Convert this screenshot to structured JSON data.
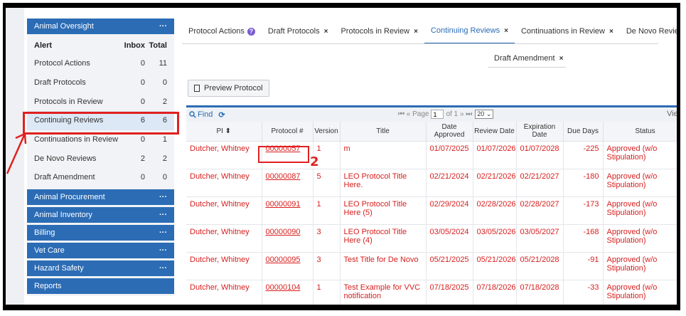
{
  "sidebar": {
    "oversight_title": "Animal Oversight",
    "col_alert": "Alert",
    "col_inbox": "Inbox",
    "col_total": "Total",
    "rows": [
      {
        "label": "Protocol Actions",
        "inbox": "0",
        "total": "11"
      },
      {
        "label": "Draft Protocols",
        "inbox": "0",
        "total": "0"
      },
      {
        "label": "Protocols in Review",
        "inbox": "0",
        "total": "2"
      },
      {
        "label": "Continuing Reviews",
        "inbox": "6",
        "total": "6"
      },
      {
        "label": "Continuations in Review",
        "inbox": "0",
        "total": "1"
      },
      {
        "label": "De Novo Reviews",
        "inbox": "2",
        "total": "2"
      },
      {
        "label": "Draft Amendment",
        "inbox": "0",
        "total": "0"
      }
    ],
    "sections": [
      "Animal Procurement",
      "Animal Inventory",
      "Billing",
      "Vet Care",
      "Hazard Safety",
      "Reports"
    ],
    "more": "···"
  },
  "tabs": {
    "protocol_actions": "Protocol Actions",
    "draft_protocols": "Draft Protocols",
    "protocols_in_review": "Protocols in Review",
    "continuing_reviews": "Continuing Reviews",
    "continuations_in_review": "Continuations in Review",
    "de_novo_reviews": "De Novo Reviews",
    "draft_amendment": "Draft Amendment",
    "close": "×",
    "help": "?"
  },
  "preview_button": "Preview Protocol",
  "grid": {
    "find": "Find",
    "page_label": "Page",
    "page_value": "1",
    "of_pages": "of 1",
    "page_size": "20",
    "view": "Vie",
    "columns": [
      "PI ⬍",
      "Protocol #",
      "Version",
      "Title",
      "Date Approved",
      "Review Date",
      "Expiration Date",
      "Due Days",
      "Status"
    ],
    "rows": [
      [
        "Dutcher, Whitney",
        "00000057",
        "1",
        "m",
        "01/07/2025",
        "01/07/2026",
        "01/07/2028",
        "-225",
        "Approved (w/o Stipulation)"
      ],
      [
        "Dutcher, Whitney",
        "00000087",
        "5",
        "LEO Protocol Title Here.",
        "02/21/2024",
        "02/21/2026",
        "02/21/2027",
        "-180",
        "Approved (w/o Stipulation)"
      ],
      [
        "Dutcher, Whitney",
        "00000091",
        "1",
        "LEO Protocol Title Here (5)",
        "02/29/2024",
        "02/28/2026",
        "02/28/2027",
        "-173",
        "Approved (w/o Stipulation)"
      ],
      [
        "Dutcher, Whitney",
        "00000090",
        "3",
        "LEO Protocol Title Here (4)",
        "03/05/2024",
        "03/05/2026",
        "03/05/2027",
        "-168",
        "Approved (w/o Stipulation)"
      ],
      [
        "Dutcher, Whitney",
        "00000095",
        "3",
        "Test Title for De Novo",
        "05/21/2025",
        "05/21/2026",
        "05/21/2028",
        "-91",
        "Approved (w/o Stipulation)"
      ],
      [
        "Dutcher, Whitney",
        "00000104",
        "1",
        "Test Example for VVC notification",
        "07/18/2025",
        "07/18/2026",
        "07/18/2028",
        "-33",
        "Approved (w/o Stipulation)"
      ]
    ]
  },
  "annotations": {
    "mark_2": "2"
  }
}
